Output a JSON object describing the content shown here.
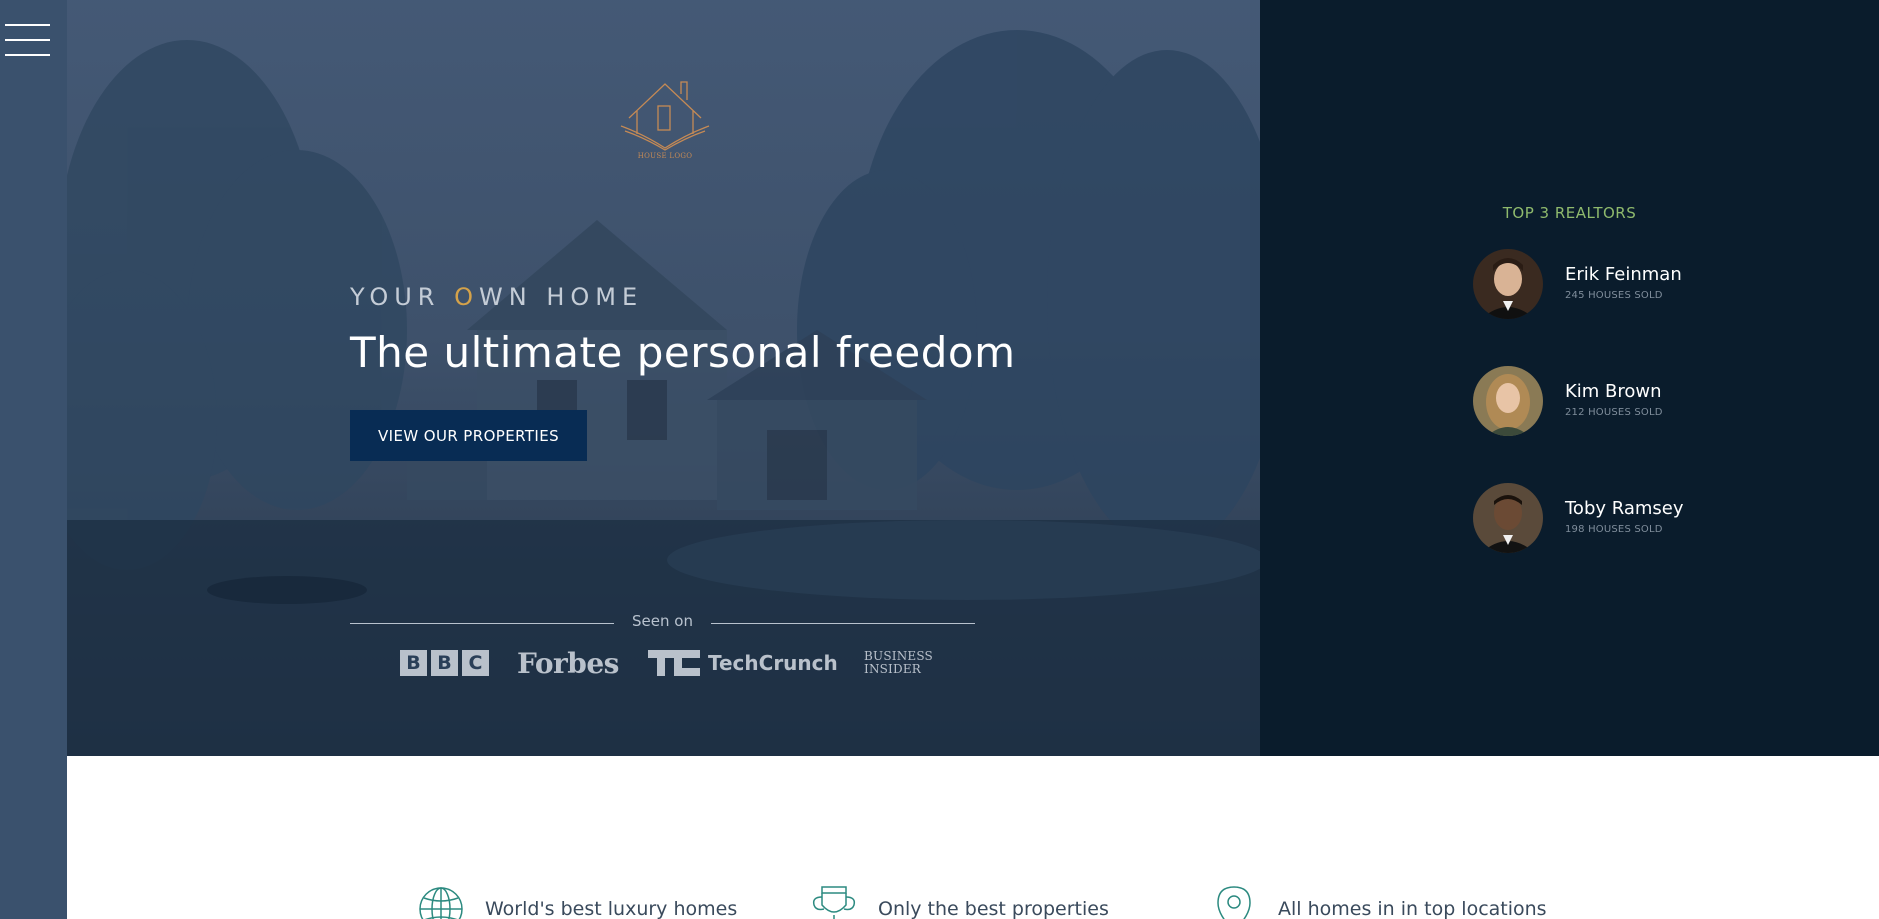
{
  "nav": {
    "menu_icon": "hamburger-menu-icon"
  },
  "logo": {
    "caption": "HOUSE LOGO",
    "icon": "house-book-logo-icon"
  },
  "hero": {
    "kicker_before": "YOUR ",
    "kicker_accent": "O",
    "kicker_after": "WN HOME",
    "headline": "The ultimate personal freedom",
    "cta_label": "VIEW OUR PROPERTIES",
    "seen_on_label": "Seen on",
    "press": {
      "bbc": [
        "B",
        "B",
        "C"
      ],
      "forbes": "Forbes",
      "techcrunch": "TechCrunch",
      "business_insider_line1": "BUSINESS",
      "business_insider_line2": "INSIDER"
    }
  },
  "realtors": {
    "title": "TOP 3 REALTORS",
    "items": [
      {
        "name": "Erik Feinman",
        "sold": "245 HOUSES SOLD"
      },
      {
        "name": "Kim Brown",
        "sold": "212 HOUSES SOLD"
      },
      {
        "name": "Toby Ramsey",
        "sold": "198 HOUSES SOLD"
      }
    ]
  },
  "features": [
    {
      "icon": "globe-icon",
      "text": "World's best luxury homes"
    },
    {
      "icon": "trophy-icon",
      "text": "Only the best properties"
    },
    {
      "icon": "map-pin-icon",
      "text": "All homes in in top locations"
    }
  ],
  "colors": {
    "sidebar": "#3a516d",
    "realtors_panel": "#0a1c2c",
    "cta": "#082c54",
    "accent_gold": "#d4a24a",
    "accent_green": "#8fba6d"
  }
}
